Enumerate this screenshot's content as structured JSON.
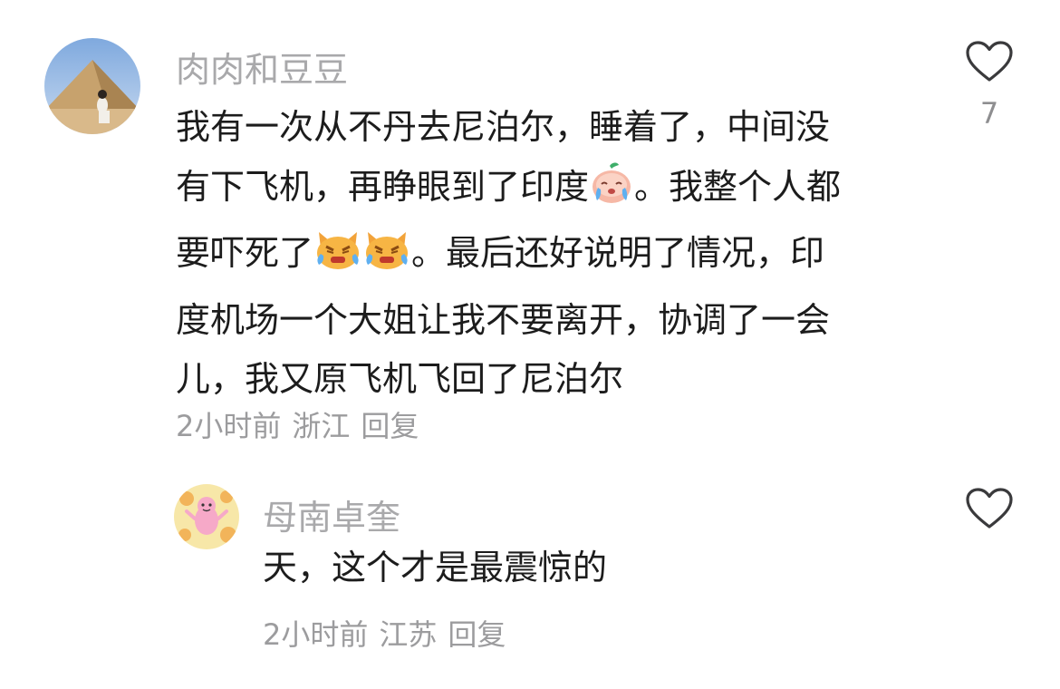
{
  "comments": [
    {
      "username": "肉肉和豆豆",
      "text_line1": "我有一次从不丹去尼泊尔，睡着了，中间没",
      "text_line2_a": "有下飞机，再睁眼到了印度",
      "text_line2_b": "。我整个人都",
      "text_line3_a": "要吓死了",
      "text_line3_b": "。最后还好说明了情况，印",
      "text_line4": "度机场一个大姐让我不要离开，协调了一会",
      "text_line5": "儿，我又原飞机飞回了尼泊尔",
      "time": "2小时前",
      "location": "浙江",
      "reply_label": "回复",
      "like_count": "7",
      "avatar_icon": "pyramid-photo-avatar",
      "inline_emojis": [
        "crying-face-emoji",
        "crying-cat-emoji",
        "crying-cat-emoji"
      ]
    },
    {
      "username": "母南卓奎",
      "text": "天，这个才是最震惊的",
      "time": "2小时前",
      "location": "江苏",
      "reply_label": "回复",
      "avatar_icon": "cartoon-doodle-avatar"
    }
  ],
  "icons": {
    "like": "heart-outline-icon"
  },
  "colors": {
    "username": "#a9a9ab",
    "text": "#1c1c1c",
    "meta": "#9c9c9e",
    "icon": "#3a3a3c"
  }
}
